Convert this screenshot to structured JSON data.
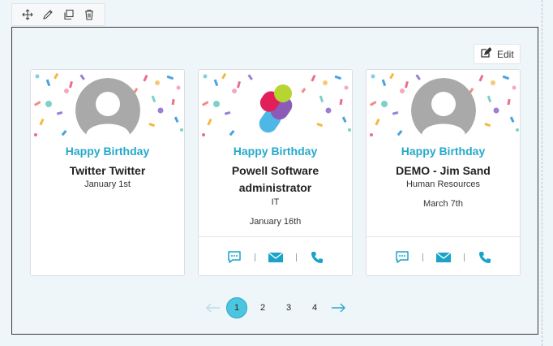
{
  "toolbar": {
    "icons": [
      "move-icon",
      "pencil-icon",
      "duplicate-icon",
      "trash-icon"
    ]
  },
  "edit_button": {
    "label": "Edit",
    "icon": "edit-icon"
  },
  "cards": [
    {
      "heading": "Happy Birthday",
      "name": "Twitter Twitter",
      "department": "",
      "date": "January 1st",
      "avatar": "default-avatar"
    },
    {
      "heading": "Happy Birthday",
      "name": "Powell Software administrator",
      "department": "IT",
      "date": "January 16th",
      "avatar": "powell-logo",
      "actions": [
        "chat-icon",
        "mail-icon",
        "phone-icon"
      ]
    },
    {
      "heading": "Happy Birthday",
      "name": "DEMO - Jim Sand",
      "department": "Human Resources",
      "date": "March 7th",
      "avatar": "default-avatar",
      "actions": [
        "chat-icon",
        "mail-icon",
        "phone-icon"
      ]
    }
  ],
  "pagination": {
    "pages": [
      "1",
      "2",
      "3",
      "4"
    ],
    "current": "1"
  },
  "colors": {
    "accent": "#25a9c9",
    "active_page": "#4cc6e0",
    "background": "#eef6fa"
  }
}
